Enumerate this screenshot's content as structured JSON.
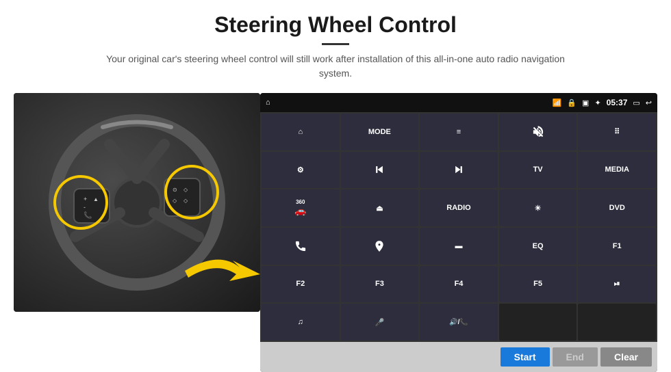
{
  "page": {
    "title": "Steering Wheel Control",
    "subtitle": "Your original car's steering wheel control will still work after installation of this all-in-one auto radio navigation system."
  },
  "status_bar": {
    "time": "05:37",
    "icons": [
      "wifi",
      "lock",
      "sim",
      "bluetooth",
      "battery",
      "screen",
      "back"
    ]
  },
  "button_grid": [
    {
      "id": "home",
      "type": "icon",
      "icon": "house",
      "label": ""
    },
    {
      "id": "mode",
      "type": "text",
      "label": "MODE"
    },
    {
      "id": "list",
      "type": "icon",
      "icon": "list",
      "label": ""
    },
    {
      "id": "mute",
      "type": "icon",
      "icon": "mute",
      "label": ""
    },
    {
      "id": "apps",
      "type": "icon",
      "icon": "apps",
      "label": ""
    },
    {
      "id": "settings",
      "type": "icon",
      "icon": "settings",
      "label": ""
    },
    {
      "id": "prev",
      "type": "icon",
      "icon": "prev",
      "label": ""
    },
    {
      "id": "next",
      "type": "icon",
      "icon": "next",
      "label": ""
    },
    {
      "id": "tv",
      "type": "text",
      "label": "TV"
    },
    {
      "id": "media",
      "type": "text",
      "label": "MEDIA"
    },
    {
      "id": "cam360",
      "type": "icon",
      "icon": "360",
      "label": "360"
    },
    {
      "id": "eject",
      "type": "icon",
      "icon": "eject",
      "label": ""
    },
    {
      "id": "radio",
      "type": "text",
      "label": "RADIO"
    },
    {
      "id": "brightness",
      "type": "icon",
      "icon": "brightness",
      "label": ""
    },
    {
      "id": "dvd",
      "type": "text",
      "label": "DVD"
    },
    {
      "id": "phone",
      "type": "icon",
      "icon": "phone",
      "label": ""
    },
    {
      "id": "nav",
      "type": "icon",
      "icon": "nav",
      "label": ""
    },
    {
      "id": "aspect",
      "type": "icon",
      "icon": "aspect",
      "label": ""
    },
    {
      "id": "eq",
      "type": "text",
      "label": "EQ"
    },
    {
      "id": "f1",
      "type": "text",
      "label": "F1"
    },
    {
      "id": "f2",
      "type": "text",
      "label": "F2"
    },
    {
      "id": "f3",
      "type": "text",
      "label": "F3"
    },
    {
      "id": "f4",
      "type": "text",
      "label": "F4"
    },
    {
      "id": "f5",
      "type": "text",
      "label": "F5"
    },
    {
      "id": "playpause",
      "type": "icon",
      "icon": "playpause",
      "label": ""
    },
    {
      "id": "music",
      "type": "icon",
      "icon": "music",
      "label": ""
    },
    {
      "id": "mic",
      "type": "icon",
      "icon": "mic",
      "label": ""
    },
    {
      "id": "vol",
      "type": "icon",
      "icon": "vol",
      "label": ""
    },
    {
      "id": "empty1",
      "type": "empty",
      "label": ""
    },
    {
      "id": "empty2",
      "type": "empty",
      "label": ""
    }
  ],
  "bottom_buttons": {
    "start_label": "Start",
    "end_label": "End",
    "clear_label": "Clear"
  },
  "colors": {
    "start_bg": "#1a7adb",
    "end_bg": "#999999",
    "clear_bg": "#888888",
    "panel_bg": "#1a1a2e",
    "btn_bg": "#2d2d3d"
  }
}
